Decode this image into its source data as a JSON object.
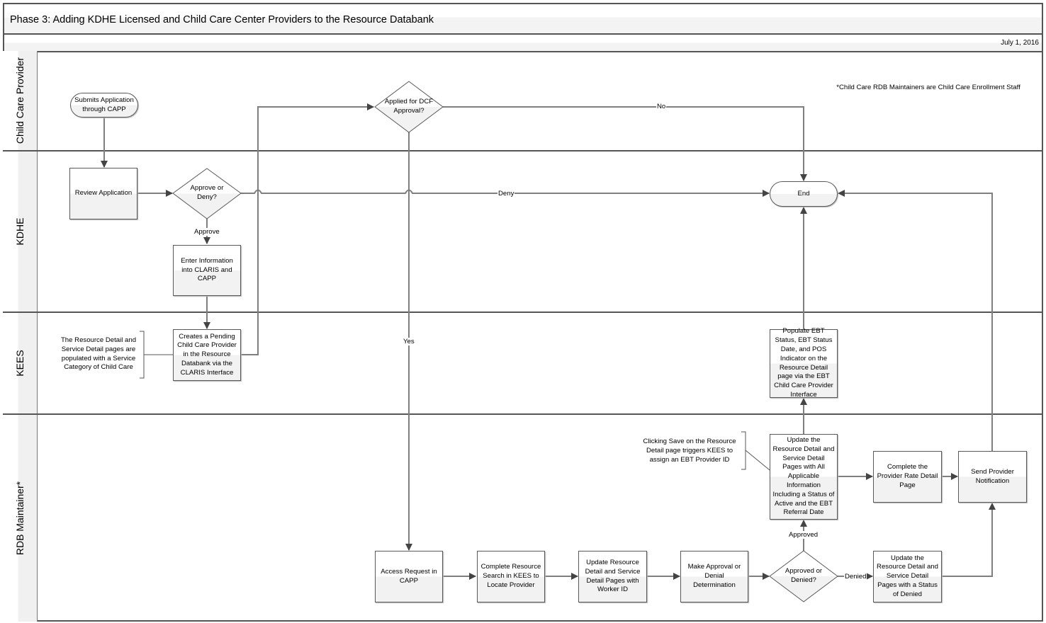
{
  "header": {
    "title": "Phase 3: Adding KDHE Licensed and Child Care Center Providers to the Resource Databank",
    "date": "July 1, 2016"
  },
  "lanes": [
    {
      "label": "Child Care Provider"
    },
    {
      "label": "KDHE"
    },
    {
      "label": "KEES"
    },
    {
      "label": "RDB Maintainer*"
    }
  ],
  "footnote": "*Child Care RDB Maintainers are Child Care Enrollment Staff",
  "nodes": {
    "submit": "Submits Application through CAPP",
    "applied_dcf": "Applied for DCF Approval?",
    "review": "Review Application",
    "approve_deny": "Approve or Deny?",
    "enter_info": "Enter Information into CLARIS and CAPP",
    "end": "End",
    "create_pending": "Creates a Pending Child Care Provider in the Resource Databank via the CLARIS Interface",
    "populate_ebt": "Populate EBT Status, EBT Status Date, and POS Indicator on the Resource Detail page via the EBT Child Care Provider Interface",
    "update_all": "Update the Resource Detail and Service Detail Pages with All Applicable Information Including a Status of Active and the EBT Referral Date",
    "complete_rate": "Complete the Provider Rate Detail Page",
    "send_notification": "Send Provider Notification",
    "access_request": "Access Request in CAPP",
    "complete_search": "Complete Resource Search in KEES to Locate Provider",
    "update_worker": "Update Resource Detail and Service Detail Pages with Worker ID",
    "make_determination": "Make Approval or Denial Determination",
    "approved_denied": "Approved or Denied?",
    "update_denied": "Update the Resource Detail and Service Detail Pages with a Status of Denied"
  },
  "annotations": {
    "kees_note": "The Resource Detail and Service Detail pages are populated with a Service Category of Child Care",
    "save_note": "Clicking Save on the Resource Detail page triggers KEES to assign an EBT Provider ID"
  },
  "edge_labels": {
    "no": "No",
    "deny": "Deny",
    "approve": "Approve",
    "yes": "Yes",
    "approved": "Approved",
    "denied": "Denied"
  }
}
